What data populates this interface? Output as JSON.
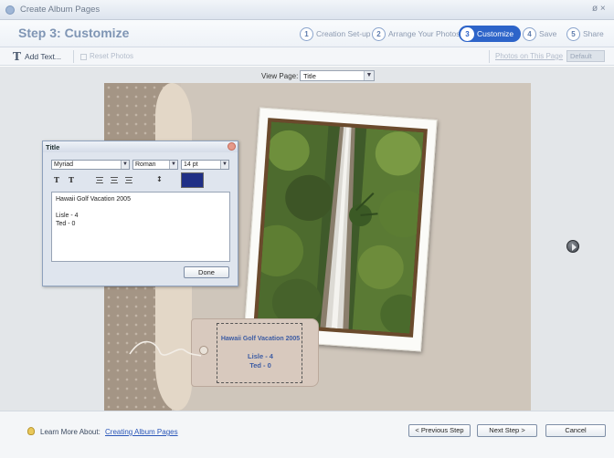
{
  "window": {
    "title": "Create Album Pages",
    "controls": "ø ×"
  },
  "header": {
    "step_title": "Step 3: Customize",
    "steps": [
      {
        "num": "1",
        "label": "Creation Set-up"
      },
      {
        "num": "2",
        "label": "Arrange Your Photos"
      },
      {
        "num": "3",
        "label": "Customize"
      },
      {
        "num": "4",
        "label": "Save"
      },
      {
        "num": "5",
        "label": "Share"
      }
    ],
    "active_step": 3
  },
  "toolbar": {
    "add_text": "Add Text...",
    "reset_photos": "Reset Photos",
    "photos_on_page_label": "Photos on This Page",
    "photos_on_page_value": "Default"
  },
  "view": {
    "label": "View Page:",
    "value": "Title"
  },
  "title_dialog": {
    "title": "Title",
    "font": "Myriad",
    "style": "Roman",
    "size": "14 pt",
    "text": "Hawaii Golf Vacation 2005\n\nLisle - 4\nTed - 0",
    "done_label": "Done"
  },
  "tag_text": {
    "line1": "Hawaii Golf Vacation 2005",
    "line2": "Lisle - 4",
    "line3": "Ted - 0"
  },
  "footer": {
    "learn_label": "Learn More About:",
    "learn_link": "Creating Album Pages",
    "previous_label": "< Previous Step",
    "next_label": "Next Step >",
    "cancel_label": "Cancel"
  },
  "colors": {
    "accent": "#2d64c9",
    "title_text_color": "#1f2f86"
  }
}
